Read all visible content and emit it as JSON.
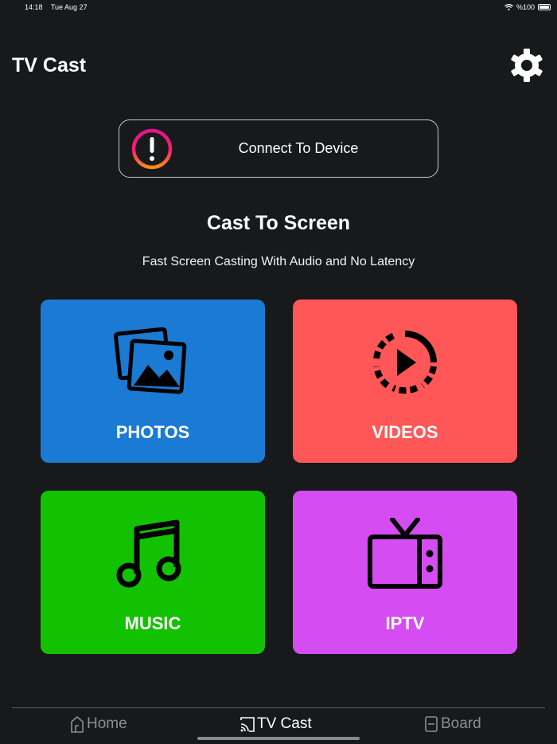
{
  "status_bar": {
    "time": "14:18",
    "date": "Tue Aug 27",
    "battery": "%100"
  },
  "header": {
    "title": "TV Cast",
    "settings_icon": "gear-icon"
  },
  "connect": {
    "label": "Connect To Device",
    "icon": "alert-icon"
  },
  "section": {
    "title": "Cast To Screen",
    "subtitle": "Fast Screen Casting With Audio and No Latency"
  },
  "tiles": [
    {
      "label": "PHOTOS",
      "icon": "photos-icon",
      "color": "#1a7ad4"
    },
    {
      "label": "VIDEOS",
      "icon": "play-circle-icon",
      "color": "#ff5757"
    },
    {
      "label": "MUSIC",
      "icon": "music-note-icon",
      "color": "#12c200"
    },
    {
      "label": "IPTV",
      "icon": "tv-icon",
      "color": "#d54df2"
    }
  ],
  "tab_bar": {
    "items": [
      {
        "label": "Home",
        "icon": "home-icon",
        "active": false
      },
      {
        "label": "TV Cast",
        "icon": "cast-icon",
        "active": true
      },
      {
        "label": "Board",
        "icon": "board-icon",
        "active": false
      }
    ]
  }
}
